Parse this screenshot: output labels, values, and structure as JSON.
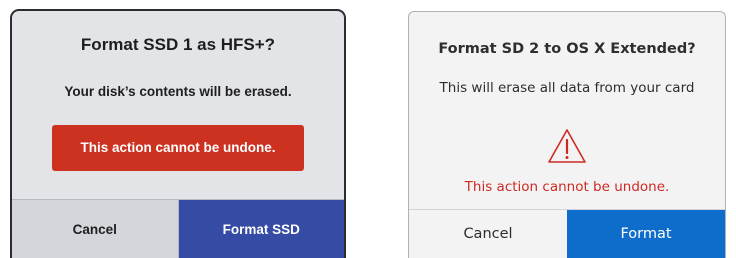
{
  "dialog_hfs": {
    "title": "Format SSD 1 as HFS+?",
    "message": "Your disk’s contents will be erased.",
    "warning": "This action cannot be undone.",
    "cancel_label": "Cancel",
    "confirm_label": "Format SSD",
    "colors": {
      "warning_bg": "#cd3120",
      "confirm_bg": "#364ba3"
    }
  },
  "dialog_osx": {
    "title": "Format SD 2 to OS X Extended?",
    "message": "This will erase all data from your card",
    "warning_icon": "warning-triangle-icon",
    "warning": "This action cannot be undone.",
    "cancel_label": "Cancel",
    "confirm_label": "Format",
    "colors": {
      "warning_text": "#cc2b25",
      "confirm_bg": "#0e6dcb"
    }
  }
}
